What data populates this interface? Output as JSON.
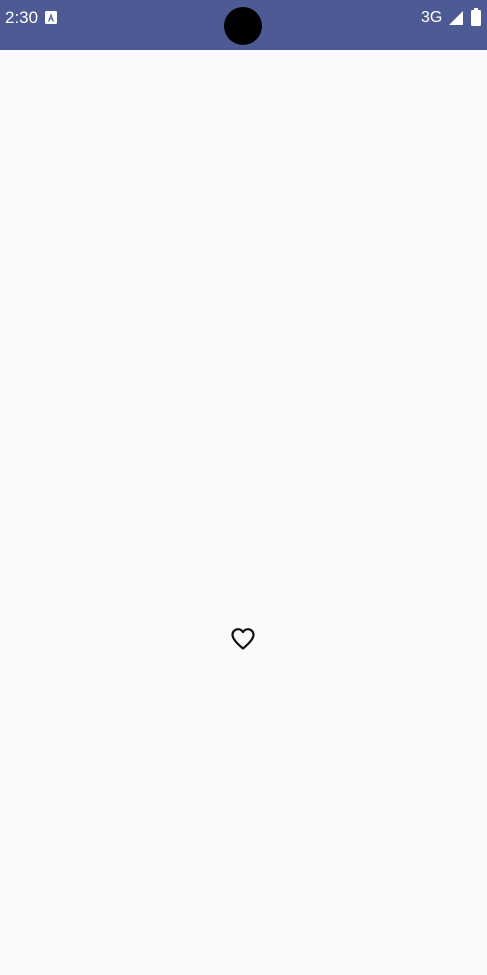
{
  "status_bar": {
    "time": "2:30",
    "network": "3G",
    "notification_icon": "a-box-icon",
    "signal_icon": "signal-icon",
    "battery_icon": "battery-icon",
    "background_color": "#4e5a93"
  },
  "main": {
    "background_color": "#fafafa",
    "favorite_icon": "heart-outline-icon"
  }
}
